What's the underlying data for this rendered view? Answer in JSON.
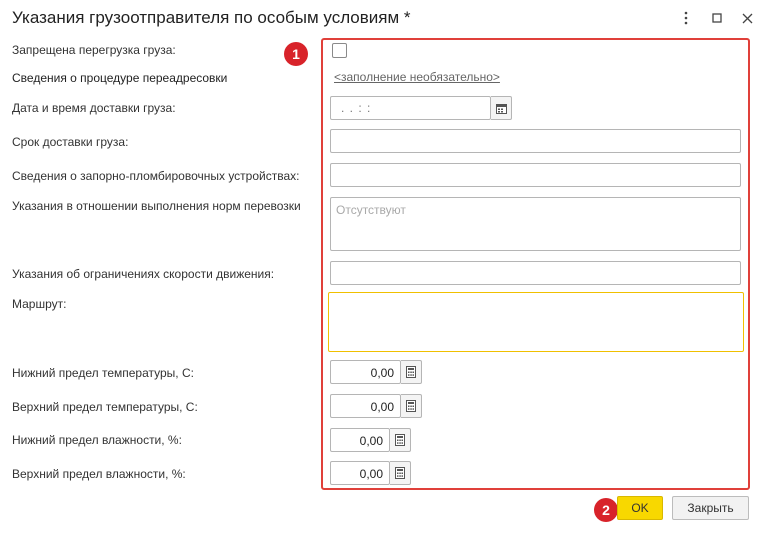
{
  "window": {
    "title": "Указания грузоотправителя по особым условиям *",
    "menu_icon": "more-vertical-icon",
    "maximize_icon": "maximize-icon",
    "close_icon": "close-icon"
  },
  "fields": {
    "no_reload_label": "Запрещена перегрузка груза:",
    "no_reload_checked": false,
    "redirect_label": "Сведения о процедуре переадресовки",
    "redirect_link": "<заполнение необязательно>",
    "delivery_datetime_label": "Дата и время доставки груза:",
    "delivery_datetime_value": " .  .     :  :",
    "delivery_term_label": "Срок доставки груза:",
    "delivery_term_value": "",
    "seal_devices_label": "Сведения о запорно-пломбировочных устройствах:",
    "seal_devices_value": "",
    "transport_norms_label": "Указания в отношении выполнения норм перевозки",
    "transport_norms_placeholder": "Отсутствуют",
    "speed_limits_label": "Указания об ограничениях скорости движения:",
    "speed_limits_value": "",
    "route_label": "Маршрут:",
    "route_value": "",
    "temp_low_label": "Нижний предел температуры, С:",
    "temp_low_value": "0,00",
    "temp_high_label": "Верхний предел температуры, С:",
    "temp_high_value": "0,00",
    "humidity_low_label": "Нижний предел влажности, %:",
    "humidity_low_value": "0,00",
    "humidity_high_label": "Верхний предел влажности, %:",
    "humidity_high_value": "0,00"
  },
  "annotations": {
    "marker1": "1",
    "marker2": "2",
    "highlight_color": "#e0403a"
  },
  "buttons": {
    "ok": "OK",
    "close": "Закрыть"
  },
  "colors": {
    "ok_button": "#f8d800",
    "focus_border": "#f0c000",
    "marker": "#d8232a"
  }
}
